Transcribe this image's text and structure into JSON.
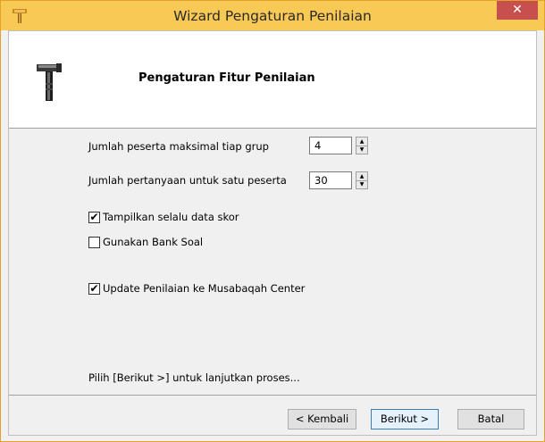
{
  "window": {
    "title": "Wizard Pengaturan Penilaian",
    "close_glyph": "✕"
  },
  "header": {
    "title": "Pengaturan Fitur Penilaian",
    "icon": "hammer-icon"
  },
  "form": {
    "max_participants_label": "Jumlah peserta maksimal tiap grup",
    "max_participants_value": "4",
    "questions_label": "Jumlah pertanyaan untuk satu peserta",
    "questions_value": "30",
    "spin_up_glyph": "▲",
    "spin_down_glyph": "▼",
    "checkboxes": [
      {
        "label": "Tampilkan selalu data skor",
        "checked": true
      },
      {
        "label": "Gunakan Bank Soal",
        "checked": false
      },
      {
        "label": "Update Penilaian ke Musabaqah Center",
        "checked": true
      }
    ],
    "check_glyph": "✔"
  },
  "footer": {
    "hint": "Pilih [Berikut >] untuk lanjutkan proses...",
    "back_label": "< Kembali",
    "next_label": "Berikut >",
    "cancel_label": "Batal"
  },
  "colors": {
    "titlebar": "#f9c955",
    "close": "#c7504e",
    "dialog_bg": "#f0f0f0"
  }
}
